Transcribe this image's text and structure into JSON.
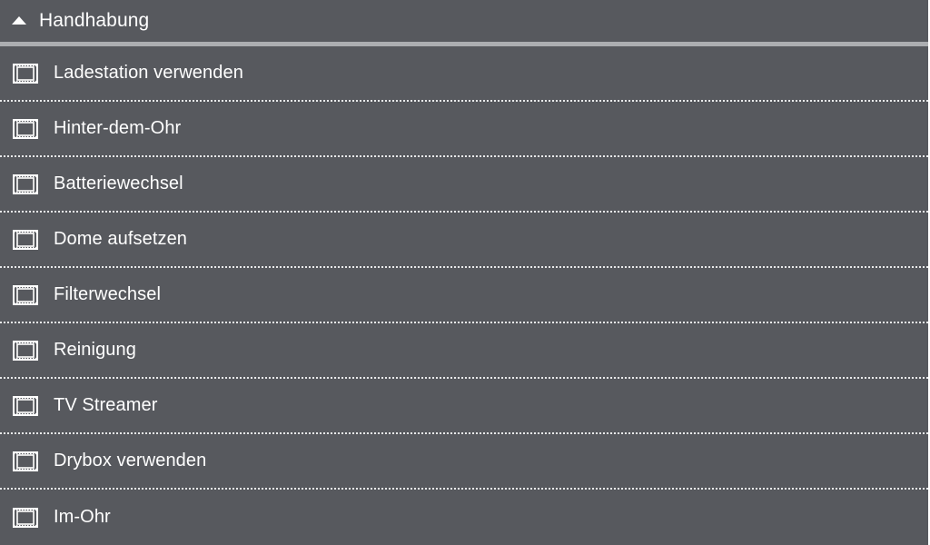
{
  "header": {
    "title": "Handhabung",
    "icon": "caret-up-icon",
    "background": "#57595e",
    "rule_color": "#acaeb1"
  },
  "list": {
    "item_icon": "film-icon",
    "items": [
      {
        "label": "Ladestation verwenden"
      },
      {
        "label": "Hinter-dem-Ohr"
      },
      {
        "label": "Batteriewechsel"
      },
      {
        "label": "Dome aufsetzen"
      },
      {
        "label": "Filterwechsel"
      },
      {
        "label": "Reinigung"
      },
      {
        "label": "TV Streamer"
      },
      {
        "label": "Drybox verwenden"
      },
      {
        "label": "Im-Ohr"
      }
    ]
  }
}
